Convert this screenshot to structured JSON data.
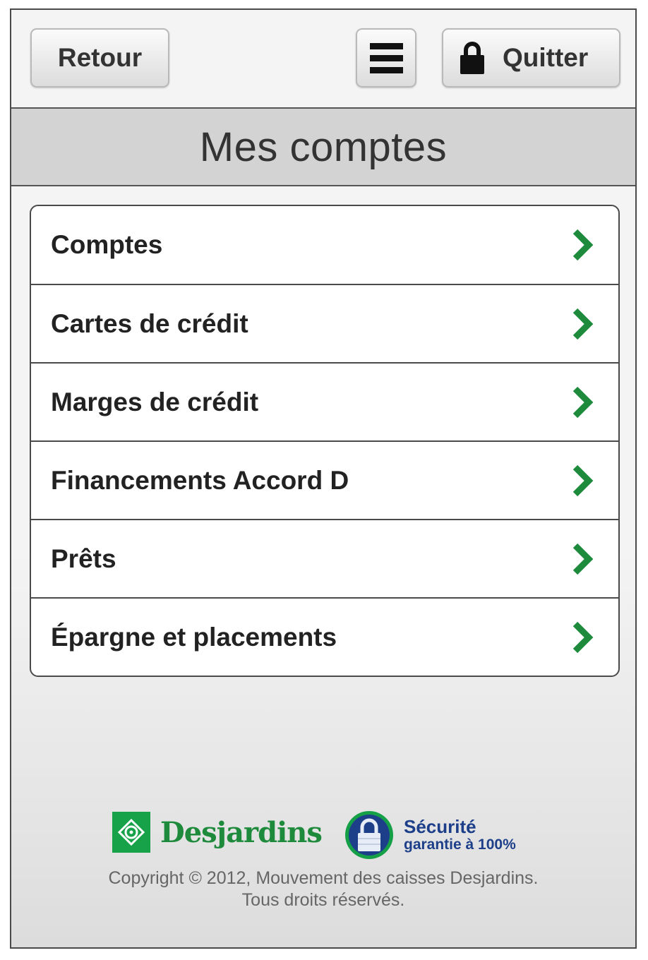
{
  "toolbar": {
    "back_label": "Retour",
    "menu_icon": "hamburger-menu-icon",
    "quit_icon": "lock-icon",
    "quit_label": "Quitter"
  },
  "page_title": "Mes comptes",
  "menu_items": [
    {
      "label": "Comptes"
    },
    {
      "label": "Cartes de crédit"
    },
    {
      "label": "Marges de crédit"
    },
    {
      "label": "Financements Accord D"
    },
    {
      "label": "Prêts"
    },
    {
      "label": "Épargne et placements"
    }
  ],
  "footer": {
    "brand_name": "Desjardins",
    "security_title": "Sécurité",
    "security_subtitle": "garantie à 100%",
    "copyright_line1": "Copyright © 2012, Mouvement des caisses Desjardins.",
    "copyright_line2": "Tous droits réservés."
  },
  "colors": {
    "chevron_green": "#1e8a3c",
    "brand_green": "#17a24a",
    "security_blue": "#1d3f8a"
  }
}
